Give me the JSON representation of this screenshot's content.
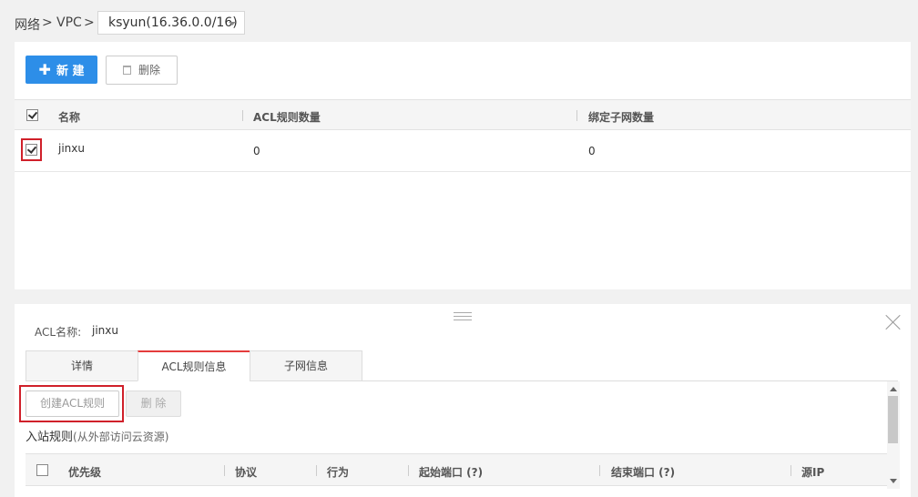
{
  "breadcrumb": {
    "network": "网络",
    "sep1": ">",
    "vpc": "VPC",
    "sep2": ">",
    "selected_vpc": "ksyun(16.36.0.0/16)"
  },
  "toolbar": {
    "new_label": "新 建",
    "delete_label": "删除"
  },
  "acl_table": {
    "columns": [
      "名称",
      "ACL规则数量",
      "绑定子网数量"
    ],
    "rows": [
      {
        "checked": true,
        "name": "jinxu",
        "rule_count": "0",
        "subnet_count": "0"
      }
    ]
  },
  "detail": {
    "acl_label": "ACL名称:",
    "acl_name": "jinxu",
    "tabs": [
      "详情",
      "ACL规则信息",
      "子网信息"
    ],
    "active_tab": 1,
    "create_rule_label": "创建ACL规则",
    "delete_label": "删 除",
    "inbound_title": "入站规则",
    "inbound_subtitle": "(从外部访问云资源)",
    "rule_columns": [
      "优先级",
      "协议",
      "行为",
      "起始端口 (?)",
      "结束端口 (?)",
      "源IP"
    ]
  },
  "colors": {
    "accent": "#2d8ee8",
    "highlight": "#d0202a",
    "active_tab": "#e43c3c"
  }
}
